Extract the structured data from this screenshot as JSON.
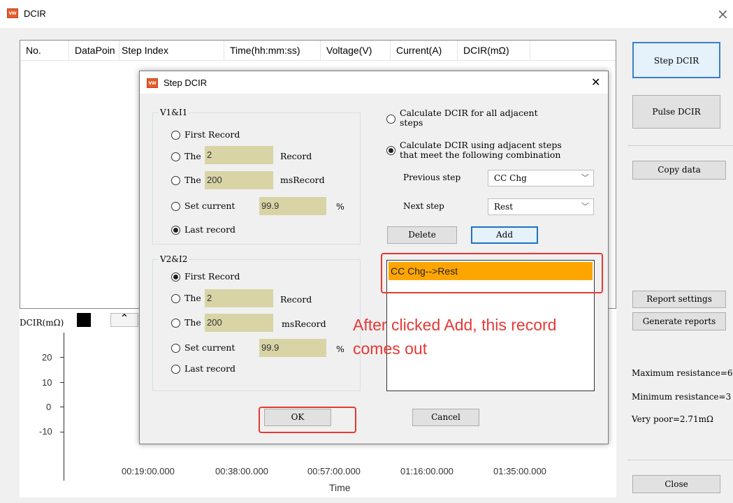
{
  "window": {
    "title": "DCIR",
    "close_glyph": "×"
  },
  "grid": {
    "columns": [
      "No.",
      "DataPoin",
      "Step Index",
      "Time(hh:mm:ss)",
      "Voltage(V)",
      "Current(A)",
      "DCIR(mΩ)"
    ]
  },
  "side_buttons": {
    "step_dcir": "Step DCIR",
    "pulse_dcir": "Pulse DCIR",
    "copy_data": "Copy data",
    "report_settings": "Report settings",
    "generate_reports": "Generate reports",
    "close": "Close"
  },
  "stats": {
    "max": "Maximum resistance=6",
    "min": "Minimum resistance=3",
    "very_poor": "Very poor=2.71mΩ"
  },
  "chart": {
    "ylabel": "DCIR(mΩ)",
    "xlabel": "Time",
    "y_ticks": [
      "20",
      "10",
      "0",
      "-10"
    ],
    "x_ticks": [
      "00:19:00.000",
      "00:38:00.000",
      "00:57:00.000",
      "01:16:00.000",
      "01:35:00.000"
    ]
  },
  "dialog": {
    "title": "Step DCIR",
    "close_glyph": "✕",
    "v1": {
      "label": "V1&I1",
      "first_record": "First Record",
      "the_label": "The",
      "record_index": "2",
      "record_suffix": "Record",
      "ms_value": "200",
      "ms_suffix": "msRecord",
      "set_current": "Set current",
      "current_value": "99.9",
      "percent": "%",
      "last_record": "Last record"
    },
    "v2": {
      "label": "V2&I2",
      "first_record": "First Record",
      "the_label": "The",
      "record_index": "2",
      "record_suffix": "Record",
      "ms_value": "200",
      "ms_suffix": "msRecord",
      "set_current": "Set current",
      "current_value": "99.9",
      "percent": "%",
      "last_record": "Last record"
    },
    "mode_all_line1": "Calculate DCIR for all adjacent",
    "mode_all_line2": "steps",
    "mode_combo_line1": "Calculate DCIR using adjacent steps",
    "mode_combo_line2": "that meet the following combination",
    "previous_step_label": "Previous step",
    "previous_step_value": "CC Chg",
    "next_step_label": "Next step",
    "next_step_value": "Rest",
    "delete": "Delete",
    "add": "Add",
    "list_items": [
      "CC Chg-->Rest"
    ],
    "ok": "OK",
    "cancel": "Cancel"
  },
  "annotation": {
    "line1": "After clicked Add, this record",
    "line2": "comes out",
    "color": "#e53935"
  }
}
